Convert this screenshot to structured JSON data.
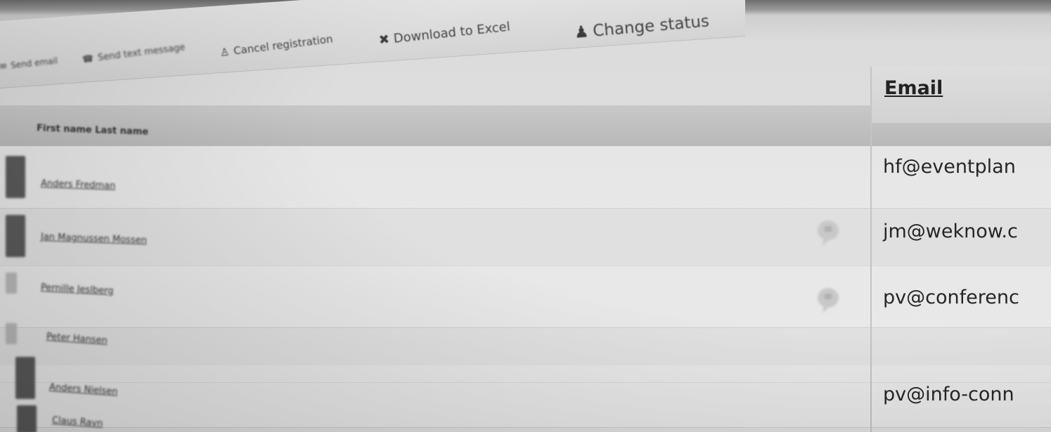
{
  "toolbar": {
    "send_email": "Send email",
    "send_text": "Send text message",
    "cancel_registration": "Cancel registration",
    "download_excel": "Download to Excel",
    "change_status": "Change status"
  },
  "table": {
    "columns": {
      "name": "First name  Last name",
      "email": "Email"
    },
    "rows": [
      {
        "name": "Anders Fredman",
        "email": "hf@eventplan",
        "has_comment": false
      },
      {
        "name": "Jan Magnussen Mossen",
        "email": "jm@weknow.c",
        "has_comment": true
      },
      {
        "name": "Pernille Jeslberg",
        "email": "pv@conferenc",
        "has_comment": true
      },
      {
        "name": "Peter Hansen",
        "email": "pv@info-conn",
        "has_comment": false
      },
      {
        "name": "Anders Nielsen",
        "email": "",
        "has_comment": false
      },
      {
        "name": "Claus Ravn",
        "email": "",
        "has_comment": false
      }
    ]
  },
  "icons": {
    "send_email": "envelope-icon",
    "send_text": "phone-icon",
    "cancel_registration": "person-cancel-icon",
    "download_excel": "excel-icon",
    "change_status": "person-status-icon",
    "comment": "speech-bubble-icon"
  }
}
